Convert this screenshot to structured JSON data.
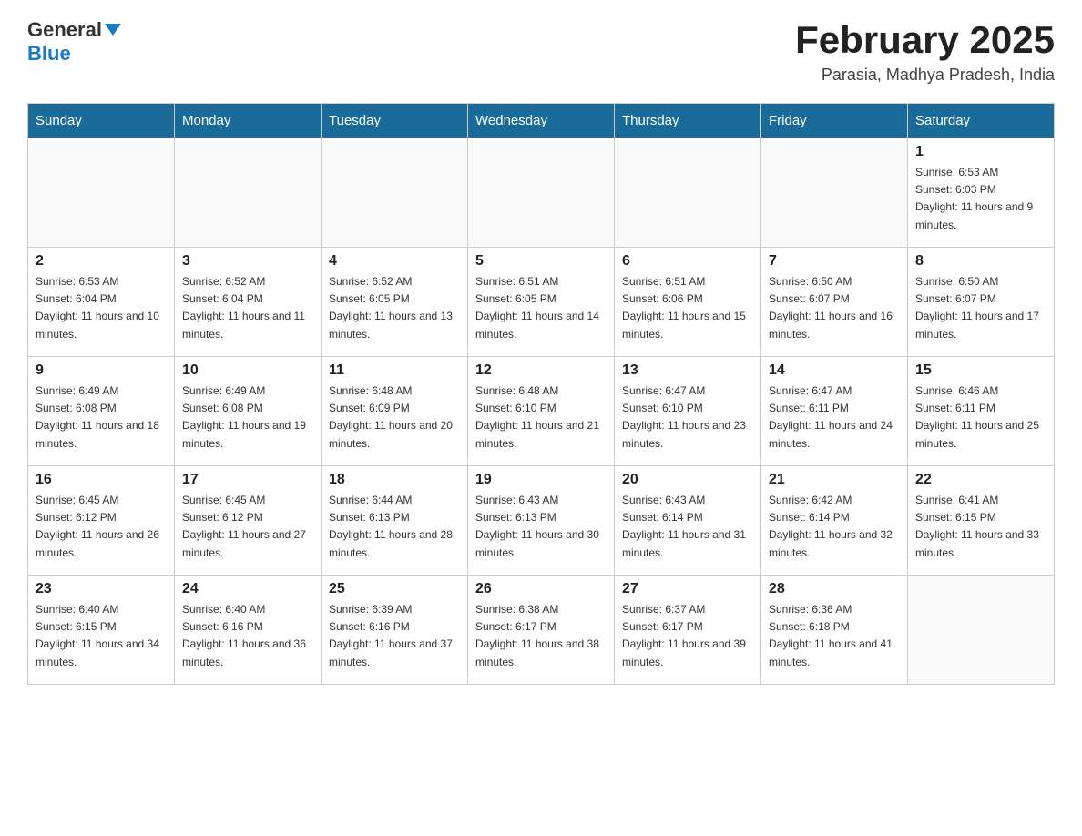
{
  "header": {
    "logo_general": "General",
    "logo_blue": "Blue",
    "month_title": "February 2025",
    "location": "Parasia, Madhya Pradesh, India"
  },
  "weekdays": [
    "Sunday",
    "Monday",
    "Tuesday",
    "Wednesday",
    "Thursday",
    "Friday",
    "Saturday"
  ],
  "weeks": [
    [
      {
        "day": "",
        "info": ""
      },
      {
        "day": "",
        "info": ""
      },
      {
        "day": "",
        "info": ""
      },
      {
        "day": "",
        "info": ""
      },
      {
        "day": "",
        "info": ""
      },
      {
        "day": "",
        "info": ""
      },
      {
        "day": "1",
        "info": "Sunrise: 6:53 AM\nSunset: 6:03 PM\nDaylight: 11 hours and 9 minutes."
      }
    ],
    [
      {
        "day": "2",
        "info": "Sunrise: 6:53 AM\nSunset: 6:04 PM\nDaylight: 11 hours and 10 minutes."
      },
      {
        "day": "3",
        "info": "Sunrise: 6:52 AM\nSunset: 6:04 PM\nDaylight: 11 hours and 11 minutes."
      },
      {
        "day": "4",
        "info": "Sunrise: 6:52 AM\nSunset: 6:05 PM\nDaylight: 11 hours and 13 minutes."
      },
      {
        "day": "5",
        "info": "Sunrise: 6:51 AM\nSunset: 6:05 PM\nDaylight: 11 hours and 14 minutes."
      },
      {
        "day": "6",
        "info": "Sunrise: 6:51 AM\nSunset: 6:06 PM\nDaylight: 11 hours and 15 minutes."
      },
      {
        "day": "7",
        "info": "Sunrise: 6:50 AM\nSunset: 6:07 PM\nDaylight: 11 hours and 16 minutes."
      },
      {
        "day": "8",
        "info": "Sunrise: 6:50 AM\nSunset: 6:07 PM\nDaylight: 11 hours and 17 minutes."
      }
    ],
    [
      {
        "day": "9",
        "info": "Sunrise: 6:49 AM\nSunset: 6:08 PM\nDaylight: 11 hours and 18 minutes."
      },
      {
        "day": "10",
        "info": "Sunrise: 6:49 AM\nSunset: 6:08 PM\nDaylight: 11 hours and 19 minutes."
      },
      {
        "day": "11",
        "info": "Sunrise: 6:48 AM\nSunset: 6:09 PM\nDaylight: 11 hours and 20 minutes."
      },
      {
        "day": "12",
        "info": "Sunrise: 6:48 AM\nSunset: 6:10 PM\nDaylight: 11 hours and 21 minutes."
      },
      {
        "day": "13",
        "info": "Sunrise: 6:47 AM\nSunset: 6:10 PM\nDaylight: 11 hours and 23 minutes."
      },
      {
        "day": "14",
        "info": "Sunrise: 6:47 AM\nSunset: 6:11 PM\nDaylight: 11 hours and 24 minutes."
      },
      {
        "day": "15",
        "info": "Sunrise: 6:46 AM\nSunset: 6:11 PM\nDaylight: 11 hours and 25 minutes."
      }
    ],
    [
      {
        "day": "16",
        "info": "Sunrise: 6:45 AM\nSunset: 6:12 PM\nDaylight: 11 hours and 26 minutes."
      },
      {
        "day": "17",
        "info": "Sunrise: 6:45 AM\nSunset: 6:12 PM\nDaylight: 11 hours and 27 minutes."
      },
      {
        "day": "18",
        "info": "Sunrise: 6:44 AM\nSunset: 6:13 PM\nDaylight: 11 hours and 28 minutes."
      },
      {
        "day": "19",
        "info": "Sunrise: 6:43 AM\nSunset: 6:13 PM\nDaylight: 11 hours and 30 minutes."
      },
      {
        "day": "20",
        "info": "Sunrise: 6:43 AM\nSunset: 6:14 PM\nDaylight: 11 hours and 31 minutes."
      },
      {
        "day": "21",
        "info": "Sunrise: 6:42 AM\nSunset: 6:14 PM\nDaylight: 11 hours and 32 minutes."
      },
      {
        "day": "22",
        "info": "Sunrise: 6:41 AM\nSunset: 6:15 PM\nDaylight: 11 hours and 33 minutes."
      }
    ],
    [
      {
        "day": "23",
        "info": "Sunrise: 6:40 AM\nSunset: 6:15 PM\nDaylight: 11 hours and 34 minutes."
      },
      {
        "day": "24",
        "info": "Sunrise: 6:40 AM\nSunset: 6:16 PM\nDaylight: 11 hours and 36 minutes."
      },
      {
        "day": "25",
        "info": "Sunrise: 6:39 AM\nSunset: 6:16 PM\nDaylight: 11 hours and 37 minutes."
      },
      {
        "day": "26",
        "info": "Sunrise: 6:38 AM\nSunset: 6:17 PM\nDaylight: 11 hours and 38 minutes."
      },
      {
        "day": "27",
        "info": "Sunrise: 6:37 AM\nSunset: 6:17 PM\nDaylight: 11 hours and 39 minutes."
      },
      {
        "day": "28",
        "info": "Sunrise: 6:36 AM\nSunset: 6:18 PM\nDaylight: 11 hours and 41 minutes."
      },
      {
        "day": "",
        "info": ""
      }
    ]
  ]
}
